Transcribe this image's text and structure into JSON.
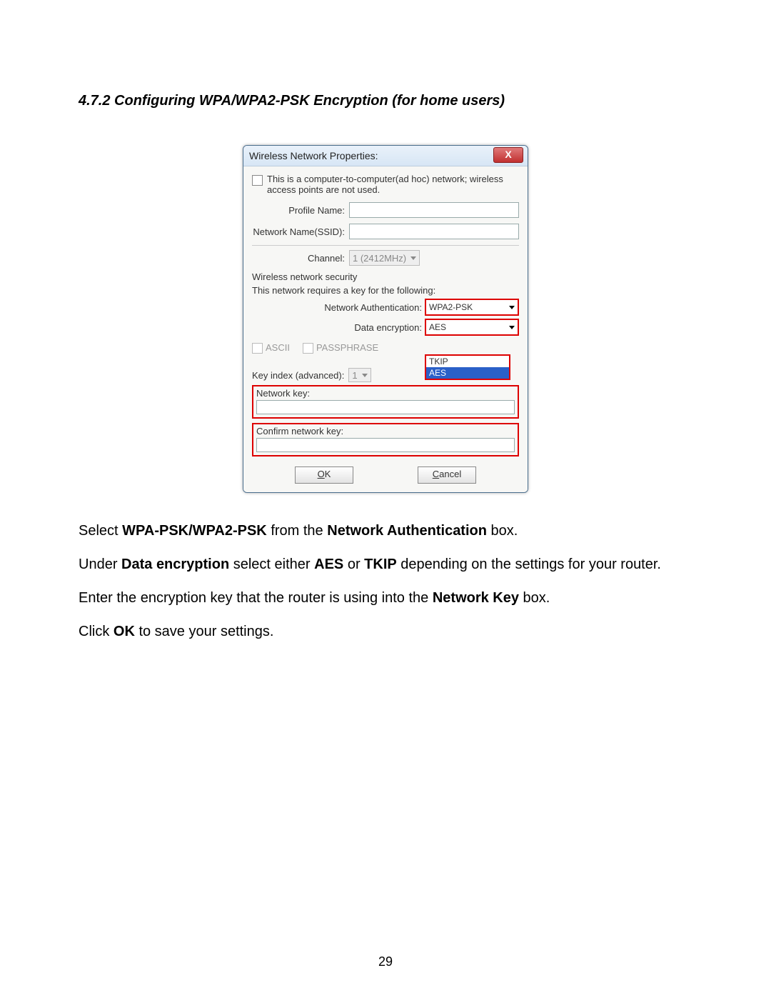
{
  "heading": "4.7.2 Configuring WPA/WPA2-PSK Encryption (for home users)",
  "dialog": {
    "title": "Wireless Network Properties:",
    "close_glyph": "X",
    "adhoc_text": "This is a computer-to-computer(ad hoc) network; wireless access points are not used.",
    "profile_label": "Profile Name:",
    "ssid_label": "Network Name(SSID):",
    "channel_label": "Channel:",
    "channel_value": "1 (2412MHz)",
    "sec_heading": "Wireless network security",
    "sec_sub": "This network requires a key for the following:",
    "auth_label": "Network Authentication:",
    "auth_value": "WPA2-PSK",
    "enc_label": "Data encryption:",
    "enc_value": "AES",
    "enc_options": {
      "o1": "TKIP",
      "o2": "AES"
    },
    "ascii_label": "ASCII",
    "pass_label": "PASSPHRASE",
    "keyidx_label": "Key index (advanced):",
    "keyidx_value": "1",
    "nk_label": "Network key:",
    "cnk_label": "Confirm network key:",
    "ok_u": "O",
    "ok_rest": "K",
    "cancel_u": "C",
    "cancel_rest": "ancel"
  },
  "para1": {
    "t1": "Select ",
    "b1": "WPA-PSK/WPA2-PSK",
    "t2": " from the ",
    "b2": "Network Authentication",
    "t3": " box."
  },
  "para2": {
    "t1": "Under ",
    "b1": "Data encryption",
    "t2": " select either ",
    "b2": "AES",
    "t3": " or ",
    "b3": "TKIP",
    "t4": " depending on the settings for your router."
  },
  "para3": {
    "t1": "Enter the encryption key that the router is using into the ",
    "b1": "Network Key",
    "t2": " box."
  },
  "para4": {
    "t1": "Click ",
    "b1": "OK",
    "t2": " to save your settings."
  },
  "page_number": "29"
}
